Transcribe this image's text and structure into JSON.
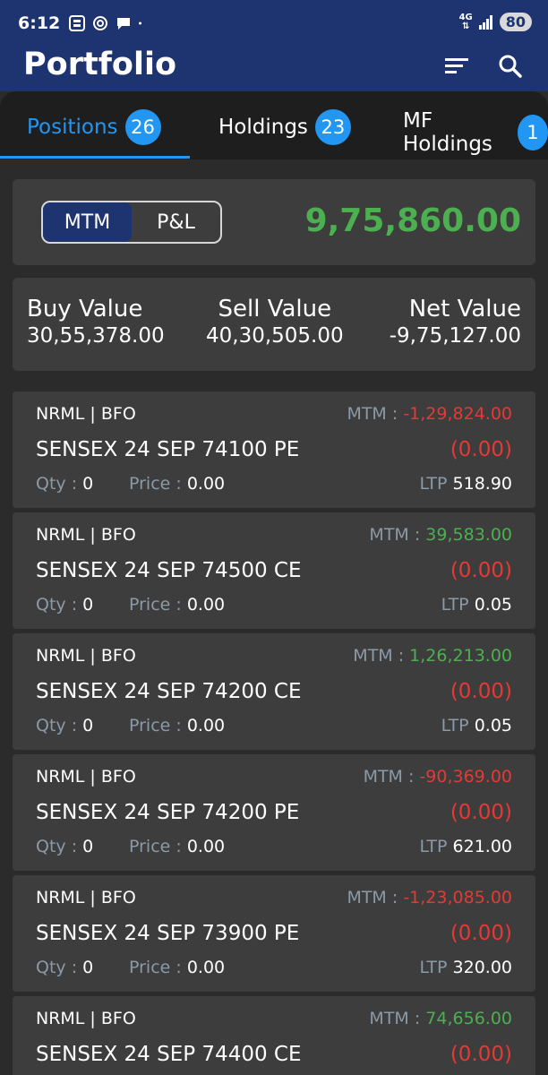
{
  "status_bar": {
    "time": "6:12",
    "network": "4G",
    "battery": "80",
    "left_icons": [
      "app-notification-icon",
      "chatgpt-icon",
      "message-icon",
      "dot-icon"
    ]
  },
  "header": {
    "title": "Portfolio",
    "icons": [
      "filter-icon",
      "search-icon"
    ]
  },
  "tabs": [
    {
      "label": "Positions",
      "count": "26",
      "active": true
    },
    {
      "label": "Holdings",
      "count": "23",
      "active": false
    },
    {
      "label": "MF Holdings",
      "count": "1",
      "active": false
    }
  ],
  "mtm_card": {
    "toggle": {
      "option1": "MTM",
      "option2": "P&L",
      "selected": "MTM"
    },
    "value": "9,75,860.00"
  },
  "summary": {
    "buy_label": "Buy Value",
    "buy_value": "30,55,378.00",
    "sell_label": "Sell Value",
    "sell_value": "40,30,505.00",
    "net_label": "Net Value",
    "net_value": "-9,75,127.00"
  },
  "labels": {
    "mtm": "MTM : ",
    "qty": "Qty : ",
    "price": "Price : ",
    "ltp": "LTP "
  },
  "positions": [
    {
      "product": "NRML | BFO",
      "mtm": "-1,29,824.00",
      "mtm_sign": "neg",
      "symbol": "SENSEX 24 SEP 74100 PE",
      "change": "(0.00)",
      "qty": "0",
      "price": "0.00",
      "ltp": "518.90"
    },
    {
      "product": "NRML | BFO",
      "mtm": "39,583.00",
      "mtm_sign": "pos",
      "symbol": "SENSEX 24 SEP 74500 CE",
      "change": "(0.00)",
      "qty": "0",
      "price": "0.00",
      "ltp": "0.05"
    },
    {
      "product": "NRML | BFO",
      "mtm": "1,26,213.00",
      "mtm_sign": "pos",
      "symbol": "SENSEX 24 SEP 74200 CE",
      "change": "(0.00)",
      "qty": "0",
      "price": "0.00",
      "ltp": "0.05"
    },
    {
      "product": "NRML | BFO",
      "mtm": "-90,369.00",
      "mtm_sign": "neg",
      "symbol": "SENSEX 24 SEP 74200 PE",
      "change": "(0.00)",
      "qty": "0",
      "price": "0.00",
      "ltp": "621.00"
    },
    {
      "product": "NRML | BFO",
      "mtm": "-1,23,085.00",
      "mtm_sign": "neg",
      "symbol": "SENSEX 24 SEP 73900 PE",
      "change": "(0.00)",
      "qty": "0",
      "price": "0.00",
      "ltp": "320.00"
    },
    {
      "product": "NRML | BFO",
      "mtm": "74,656.00",
      "mtm_sign": "pos",
      "symbol": "SENSEX 24 SEP 74400 CE",
      "change": "(0.00)",
      "qty": "",
      "price": "",
      "ltp": ""
    }
  ],
  "colors": {
    "header": "#1d3470",
    "accent": "#2196f3",
    "positive": "#4caf50",
    "negative": "#e53935"
  }
}
